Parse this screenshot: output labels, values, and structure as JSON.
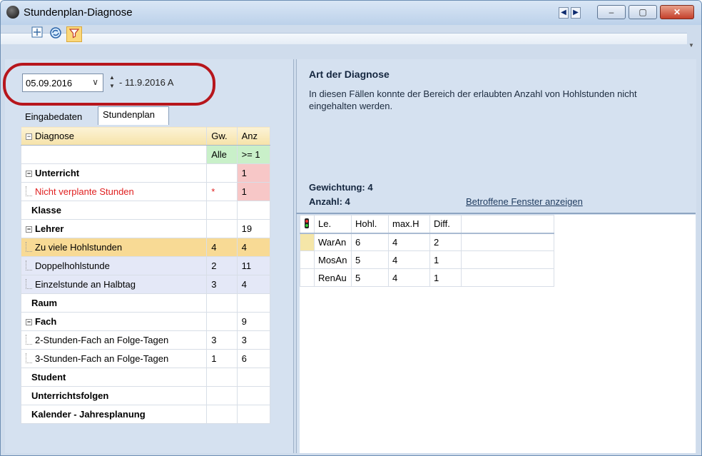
{
  "window": {
    "title": "Stundenplan-Diagnose"
  },
  "titlebar": {
    "prev": "◀",
    "next": "▶",
    "minimize": "–",
    "maximize": "▢",
    "close": "✕"
  },
  "toolbar": {
    "icons": [
      "expand-icon",
      "refresh-icon",
      "filter-icon"
    ]
  },
  "date": {
    "value": "05.09.2016",
    "range": "- 11.9.2016 A"
  },
  "tabs": [
    "Eingabedaten",
    "Stundenplan"
  ],
  "grid": {
    "headers": [
      "Diagnose",
      "Gw.",
      "Anz"
    ],
    "filter": {
      "gw": "Alle",
      "anz": ">= 1"
    },
    "rows": [
      {
        "label": "Unterricht",
        "gw": "",
        "anz": "1"
      },
      {
        "label": "Nicht verplante Stunden",
        "gw": "*",
        "anz": "1"
      },
      {
        "label": "Klasse",
        "gw": "",
        "anz": ""
      },
      {
        "label": "Lehrer",
        "gw": "",
        "anz": "19"
      },
      {
        "label": "Zu viele Hohlstunden",
        "gw": "4",
        "anz": "4"
      },
      {
        "label": "Doppelhohlstunde",
        "gw": "2",
        "anz": "11"
      },
      {
        "label": "Einzelstunde an Halbtag",
        "gw": "3",
        "anz": "4"
      },
      {
        "label": "Raum",
        "gw": "",
        "anz": ""
      },
      {
        "label": "Fach",
        "gw": "",
        "anz": "9"
      },
      {
        "label": "2-Stunden-Fach an Folge-Tagen",
        "gw": "3",
        "anz": "3"
      },
      {
        "label": "3-Stunden-Fach an Folge-Tagen",
        "gw": "1",
        "anz": "6"
      },
      {
        "label": "Student",
        "gw": "",
        "anz": ""
      },
      {
        "label": "Unterrichtsfolgen",
        "gw": "",
        "anz": ""
      },
      {
        "label": "Kalender - Jahresplanung",
        "gw": "",
        "anz": ""
      }
    ]
  },
  "detail": {
    "title": "Art der Diagnose",
    "description": "In diesen Fällen konnte der Bereich der erlaubten Anzahl von Hohlstunden nicht eingehalten werden.",
    "gewichtung": "Gewichtung: 4",
    "anzahl": "Anzahl: 4",
    "link": "Betroffene Fenster anzeigen"
  },
  "result_grid": {
    "headers": [
      "Le.",
      "Hohl.",
      "max.H",
      "Diff."
    ],
    "rows": [
      [
        "WarAn",
        "6",
        "4",
        "2"
      ],
      [
        "MosAn",
        "5",
        "4",
        "1"
      ],
      [
        "RenAu",
        "5",
        "4",
        "1"
      ]
    ]
  }
}
